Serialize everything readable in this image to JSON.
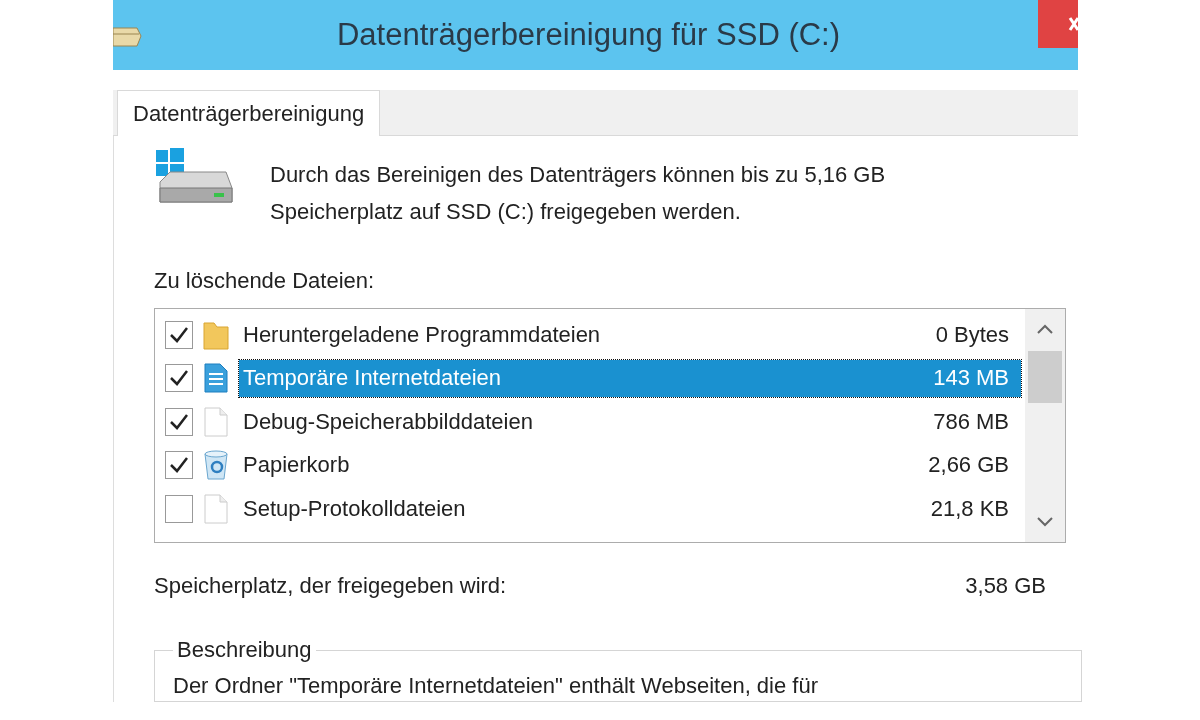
{
  "window": {
    "title": "Datenträgerbereinigung für SSD (C:)"
  },
  "tabs": [
    {
      "label": "Datenträgerbereinigung",
      "selected": true
    }
  ],
  "intro": "Durch das Bereinigen des Datenträgers können bis zu 5,16 GB Speicherplatz auf SSD (C:) freigegeben werden.",
  "files_label": "Zu löschende Dateien:",
  "files": [
    {
      "name": "Heruntergeladene Programmdateien",
      "size": "0 Bytes",
      "checked": true,
      "selected": false,
      "kind": "folder"
    },
    {
      "name": "Temporäre Internetdateien",
      "size": "143 MB",
      "checked": true,
      "selected": true,
      "kind": "web"
    },
    {
      "name": "Debug-Speicherabbilddateien",
      "size": "786 MB",
      "checked": true,
      "selected": false,
      "kind": "file"
    },
    {
      "name": "Papierkorb",
      "size": "2,66 GB",
      "checked": true,
      "selected": false,
      "kind": "bin"
    },
    {
      "name": "Setup-Protokolldateien",
      "size": "21,8 KB",
      "checked": false,
      "selected": false,
      "kind": "file"
    }
  ],
  "space_label": "Speicherplatz, der freigegeben wird:",
  "space_value": "3,58 GB",
  "description": {
    "title": "Beschreibung",
    "text": "Der Ordner \"Temporäre Internetdateien\" enthält Webseiten, die für"
  }
}
